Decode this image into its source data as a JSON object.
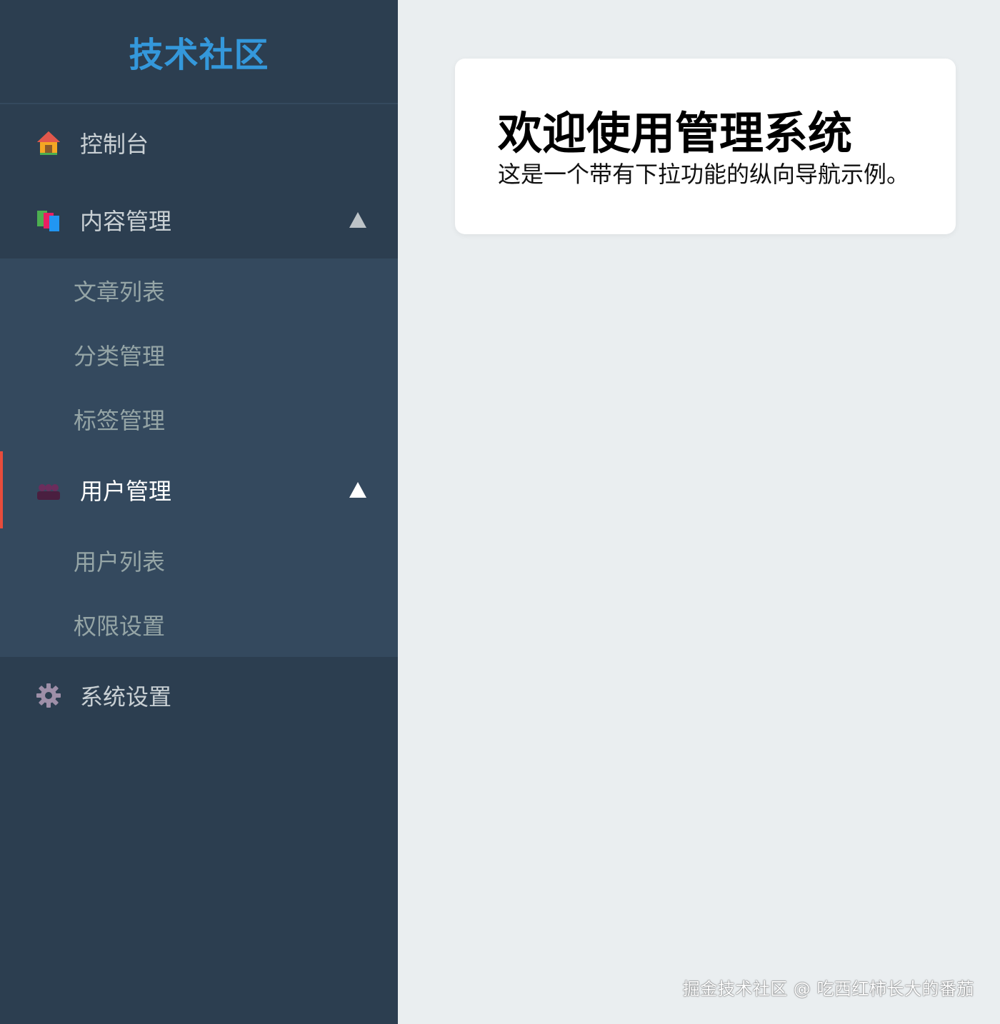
{
  "sidebar": {
    "brand": "技术社区",
    "items": [
      {
        "label": "控制台",
        "icon": "house-icon"
      },
      {
        "label": "内容管理",
        "icon": "books-icon",
        "expanded": true,
        "children": [
          {
            "label": "文章列表"
          },
          {
            "label": "分类管理"
          },
          {
            "label": "标签管理"
          }
        ]
      },
      {
        "label": "用户管理",
        "icon": "users-icon",
        "expanded": true,
        "active": true,
        "children": [
          {
            "label": "用户列表"
          },
          {
            "label": "权限设置"
          }
        ]
      },
      {
        "label": "系统设置",
        "icon": "gear-icon"
      }
    ]
  },
  "main": {
    "title": "欢迎使用管理系统",
    "description": "这是一个带有下拉功能的纵向导航示例。"
  },
  "watermark": "掘金技术社区 @ 吃西红柿长大的番茄",
  "colors": {
    "sidebar_bg": "#2c3e50",
    "submenu_bg": "#34495e",
    "brand": "#3498db",
    "active_border": "#e74c3c",
    "page_bg": "#eaeef0"
  }
}
